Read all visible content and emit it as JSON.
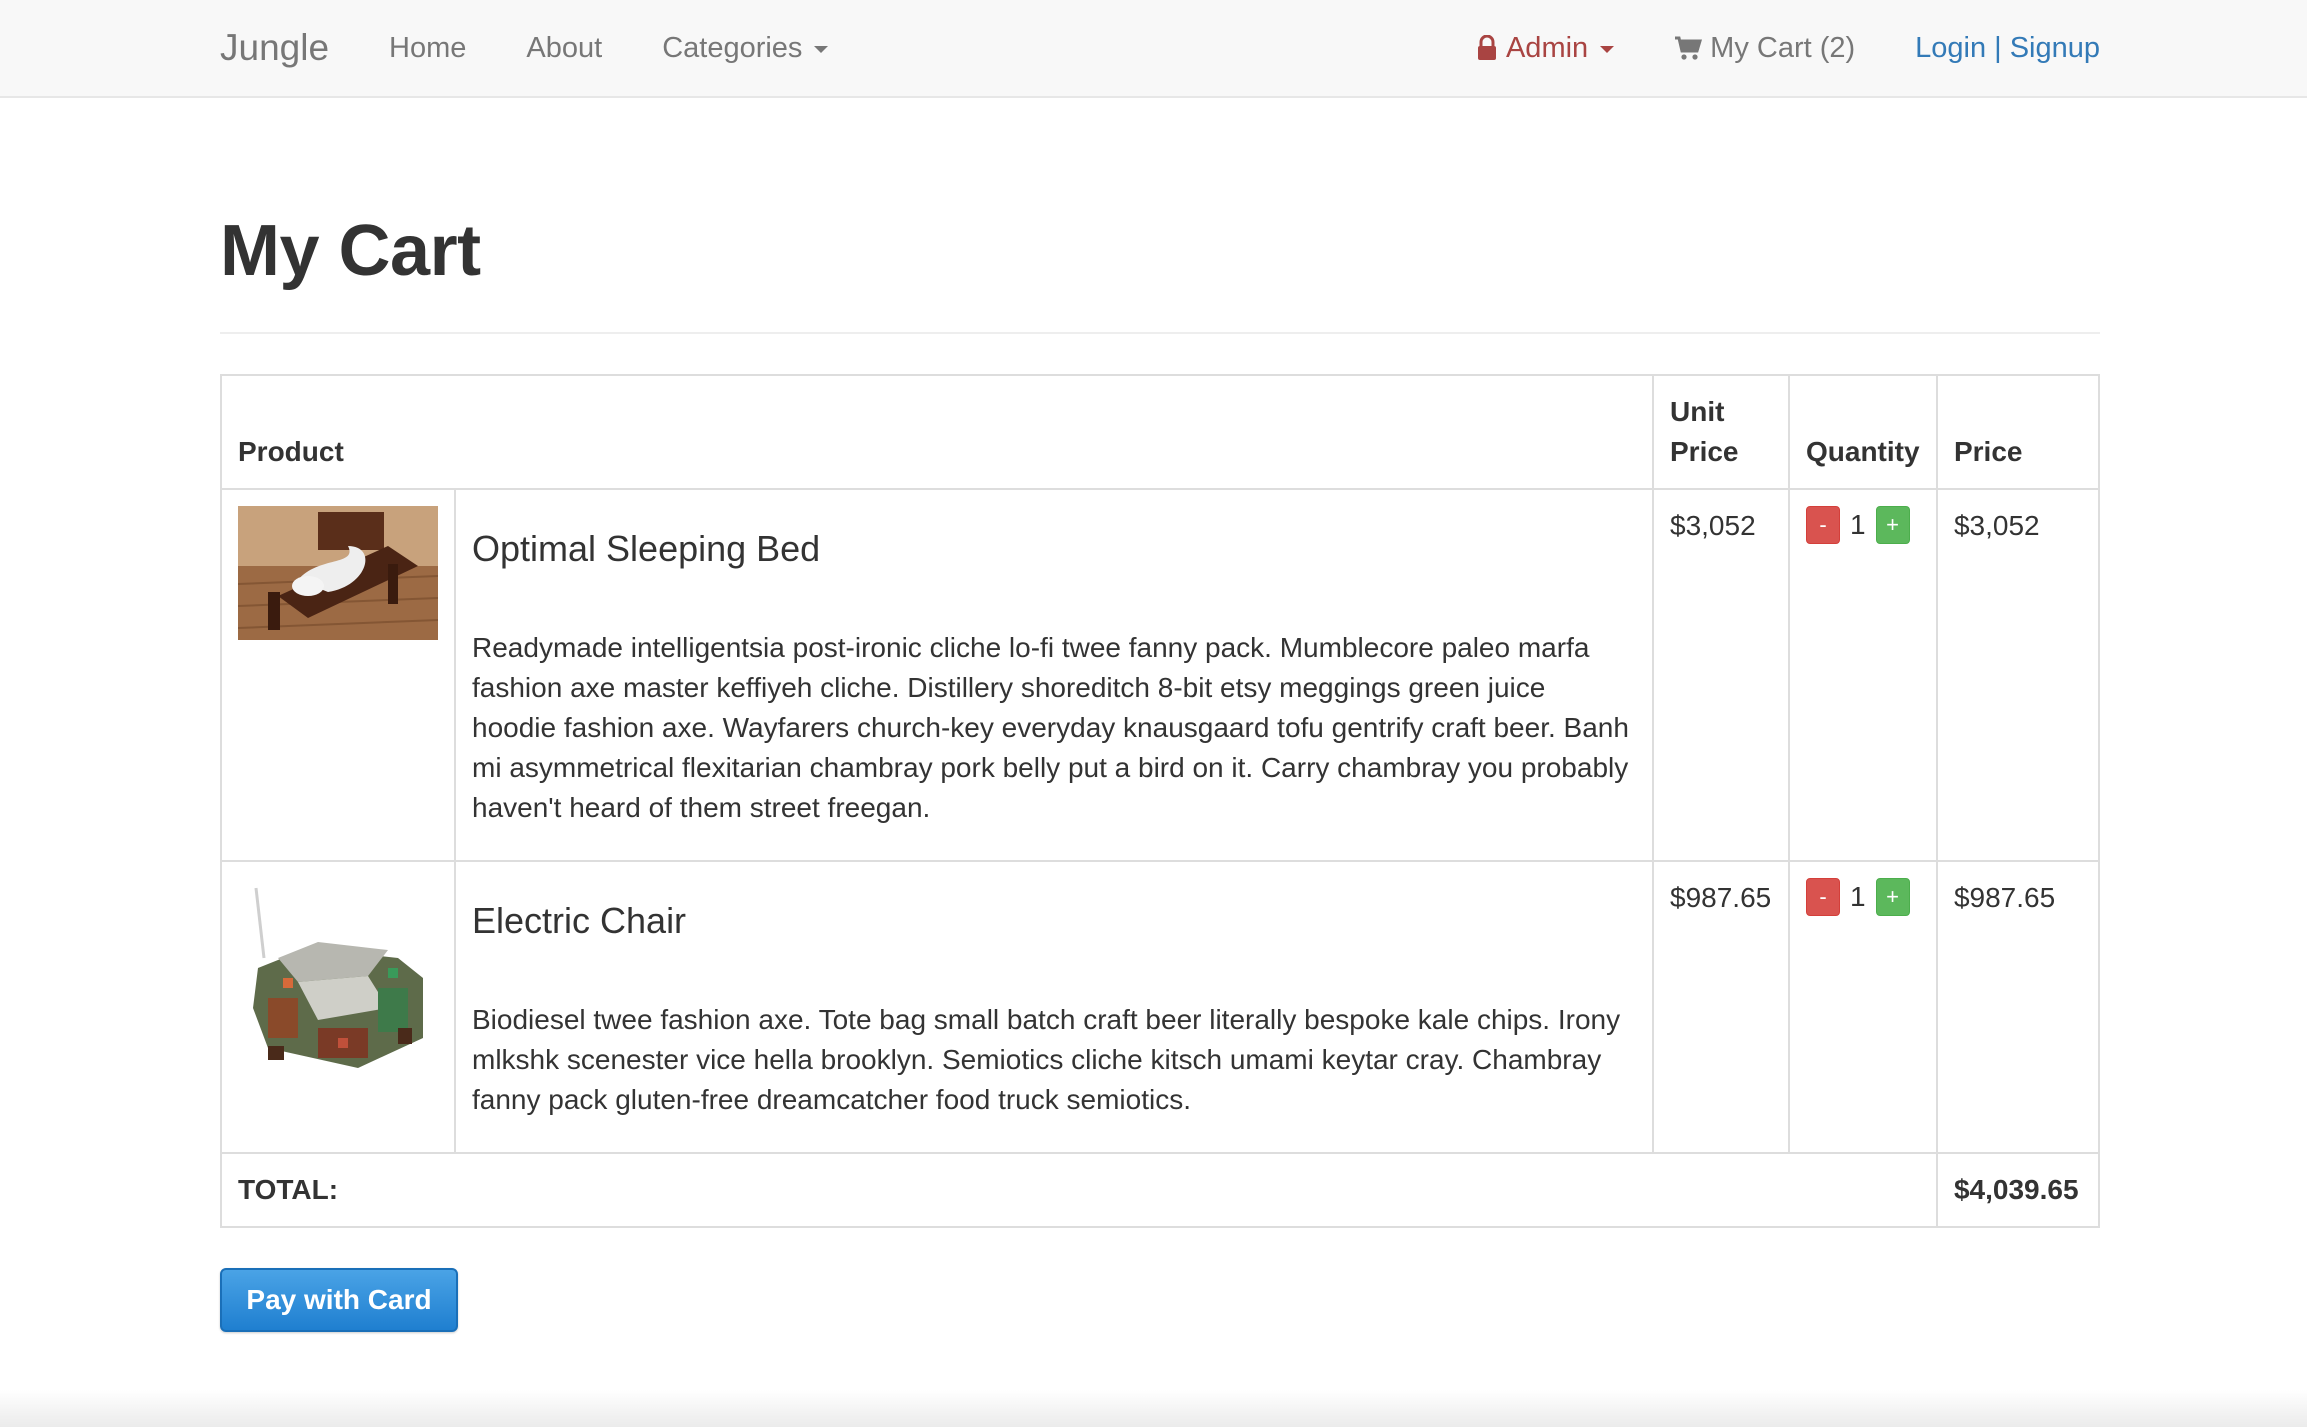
{
  "nav": {
    "brand": "Jungle",
    "home": "Home",
    "about": "About",
    "categories": "Categories",
    "admin": "Admin",
    "cart": "My Cart (2)",
    "login": "Login",
    "separator": "|",
    "signup": "Signup"
  },
  "page": {
    "title": "My Cart"
  },
  "table": {
    "headers": {
      "product": "Product",
      "unit_price_line1": "Unit",
      "unit_price_line2": "Price",
      "quantity": "Quantity",
      "price": "Price"
    },
    "items": [
      {
        "name": "Optimal Sleeping Bed",
        "description": "Readymade intelligentsia post-ironic cliche lo-fi twee fanny pack. Mumblecore paleo marfa fashion axe master keffiyeh cliche. Distillery shoreditch 8-bit etsy meggings green juice hoodie fashion axe. Wayfarers church-key everyday knausgaard tofu gentrify craft beer. Banh mi asymmetrical flexitarian chambray pork belly put a bird on it. Carry chambray you probably haven't heard of them street freegan.",
        "unit_price": "$3,052",
        "quantity": "1",
        "price": "$3,052"
      },
      {
        "name": "Electric Chair",
        "description": "Biodiesel twee fashion axe. Tote bag small batch craft beer literally bespoke kale chips. Irony mlkshk scenester vice hella brooklyn. Semiotics cliche kitsch umami keytar cray. Chambray fanny pack gluten-free dreamcatcher food truck semiotics.",
        "unit_price": "$987.65",
        "quantity": "1",
        "price": "$987.65"
      }
    ],
    "qty_minus": "-",
    "qty_plus": "+",
    "total_label": "TOTAL:",
    "total_value": "$4,039.65"
  },
  "pay_button": "Pay with Card",
  "colors": {
    "link": "#337ab7",
    "admin": "#a94442",
    "minus": "#d9534f",
    "plus": "#5cb85c",
    "pay": "#1f7fd0"
  }
}
